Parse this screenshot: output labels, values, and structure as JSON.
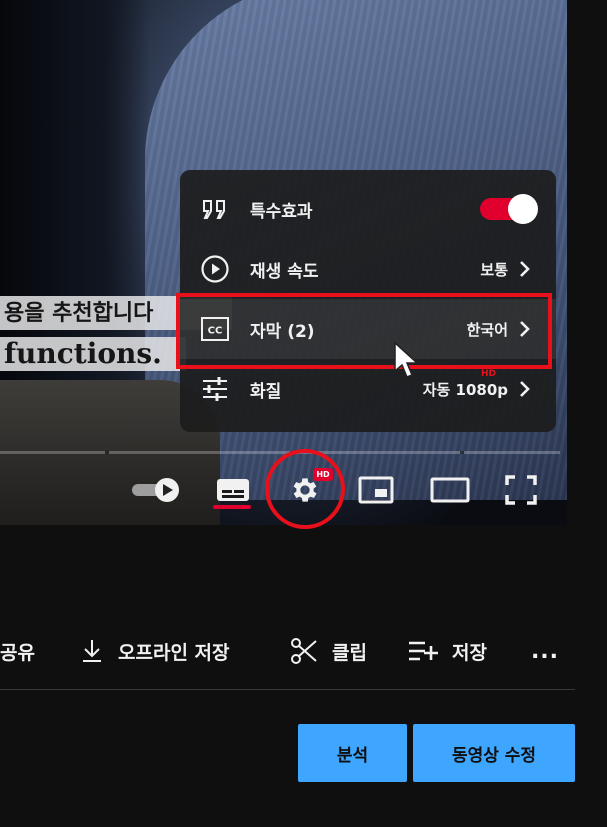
{
  "player": {
    "subtitle_line1": "용을 추천합니다",
    "subtitle_line2": "functions.",
    "controls": {
      "autoplay_icon": "autoplay-toggle-icon",
      "subtitles_icon": "subtitles-icon",
      "settings_icon": "gear-icon",
      "settings_badge": "HD",
      "miniplayer_icon": "miniplayer-icon",
      "theater_icon": "theater-mode-icon",
      "fullscreen_icon": "fullscreen-icon"
    }
  },
  "settings_menu": {
    "items": [
      {
        "icon": "quote-icon",
        "label": "특수효과",
        "value": "",
        "toggle_on": true
      },
      {
        "icon": "play-circle-icon",
        "label": "재생 속도",
        "value": "보통"
      },
      {
        "icon": "cc-icon",
        "label": "자막 (2)",
        "value": "한국어"
      },
      {
        "icon": "sliders-icon",
        "label": "화질",
        "value": "자동 1080p",
        "badge": "HD"
      }
    ],
    "highlight_color": "#e8101a",
    "toggle_color": "#e1002d"
  },
  "actions": {
    "share": "공유",
    "offline": "오프라인 저장",
    "clip": "클립",
    "save": "저장",
    "more": "..."
  },
  "buttons": {
    "analytics": "분석",
    "edit_video": "동영상 수정",
    "accent": "#3ea6ff"
  }
}
